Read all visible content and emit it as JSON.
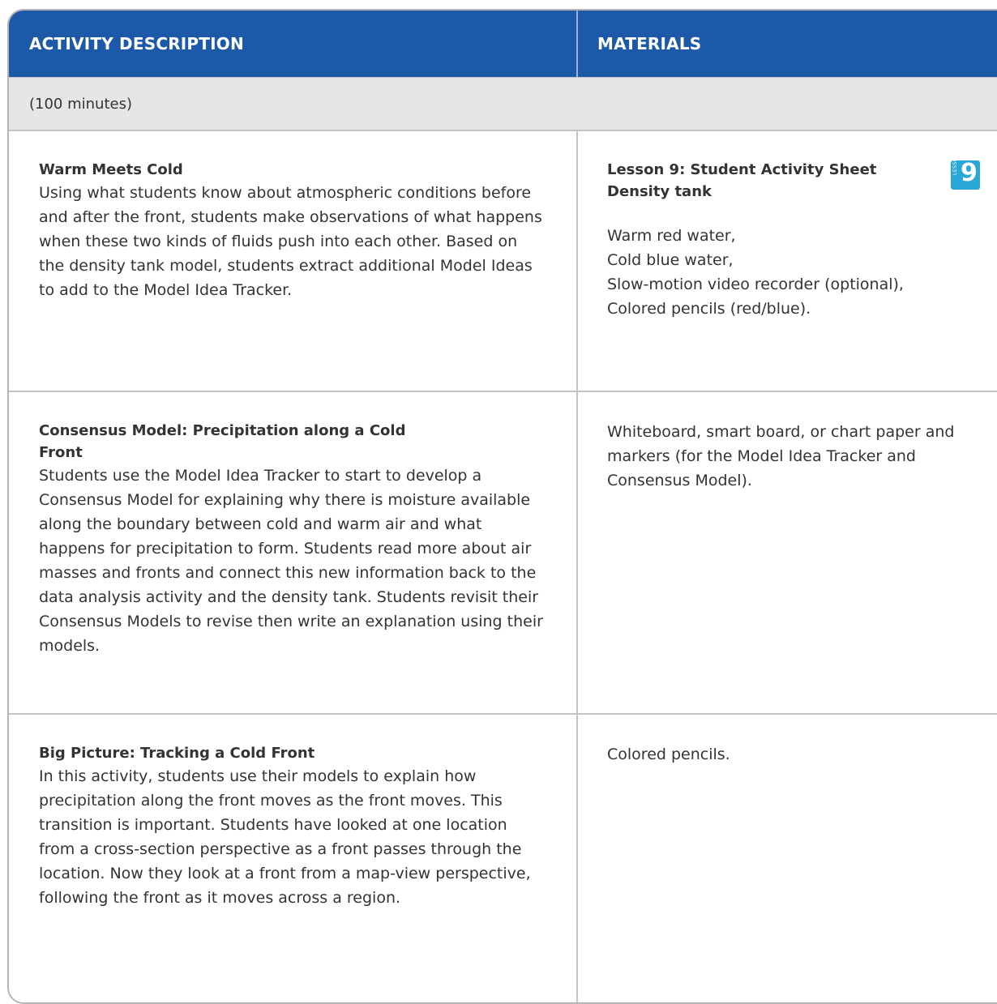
{
  "header": {
    "activity_label": "ACTIVITY DESCRIPTION",
    "materials_label": "MATERIALS"
  },
  "duration": "(100 minutes)",
  "activities": [
    {
      "title": "Warm Meets Cold",
      "description": "Using what students know about atmospheric conditions before and after the front, students make observations of what happens when these two kinds of fluids push into each other. Based on the density tank model, students extract additional Model Ideas to add to the Model Idea Tracker.",
      "materials_heading": "Lesson 9: Student Activity Sheet",
      "materials_subheading": "Density tank",
      "materials_list": [
        "Warm red water,",
        "Cold blue water,",
        "Slow-motion video recorder (optional),",
        "Colored pencils (red/blue)."
      ],
      "badge": {
        "word": "LESSON",
        "number": "9",
        "color": "#29a8d8"
      }
    },
    {
      "title": "Consensus Model: Precipitation along a Cold Front",
      "description": "Students use the Model Idea Tracker to start to develop a Consensus Model for explaining why there is moisture available along the boundary between cold and warm air and what happens for precipitation to form. Students read more about air masses and fronts and connect this new information back to the data analysis activity and the density tank. Students revisit their Consensus Models to revise then write an explanation using their models.",
      "materials_text": "Whiteboard, smart board, or chart paper and markers (for the Model Idea Tracker and Consensus Model)."
    },
    {
      "title": "Big Picture: Tracking a Cold Front",
      "description": "In this activity, students use their models to explain how precipitation along the front moves as the front moves. This transition is important. Students have looked at one location from a cross-section perspective as a front passes through the location. Now they look at a front from a map-view perspective, following the front as it moves across a region.",
      "materials_text": "Colored pencils."
    }
  ],
  "colors": {
    "header_bg": "#1c59a9",
    "subheader_bg": "#e5e6e8",
    "text": "#333333",
    "border": "#c4c4c4"
  }
}
